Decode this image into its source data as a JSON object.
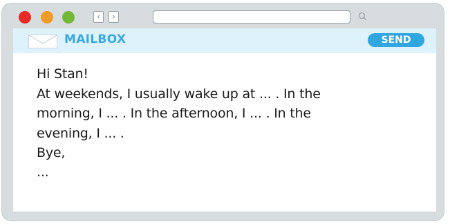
{
  "toolbar": {
    "back_glyph": "‹",
    "forward_glyph": "›",
    "url_value": ""
  },
  "header": {
    "title": "MAILBOX",
    "send_label": "SEND"
  },
  "message": {
    "lines": [
      "Hi Stan!",
      "At weekends, I usually wake up at ... . In the",
      "morning, I ... . In the afternoon, I ... . In the",
      "evening, I ... .",
      "Bye,",
      "..."
    ]
  },
  "colors": {
    "close": "#e82a24",
    "minimize": "#f19a26",
    "maximize": "#74b83a",
    "accent": "#2fa6e0",
    "header_bg": "#def2fc",
    "frame": "#d7dcdf"
  },
  "icons": {
    "envelope": "envelope-icon",
    "search": "search-icon"
  }
}
